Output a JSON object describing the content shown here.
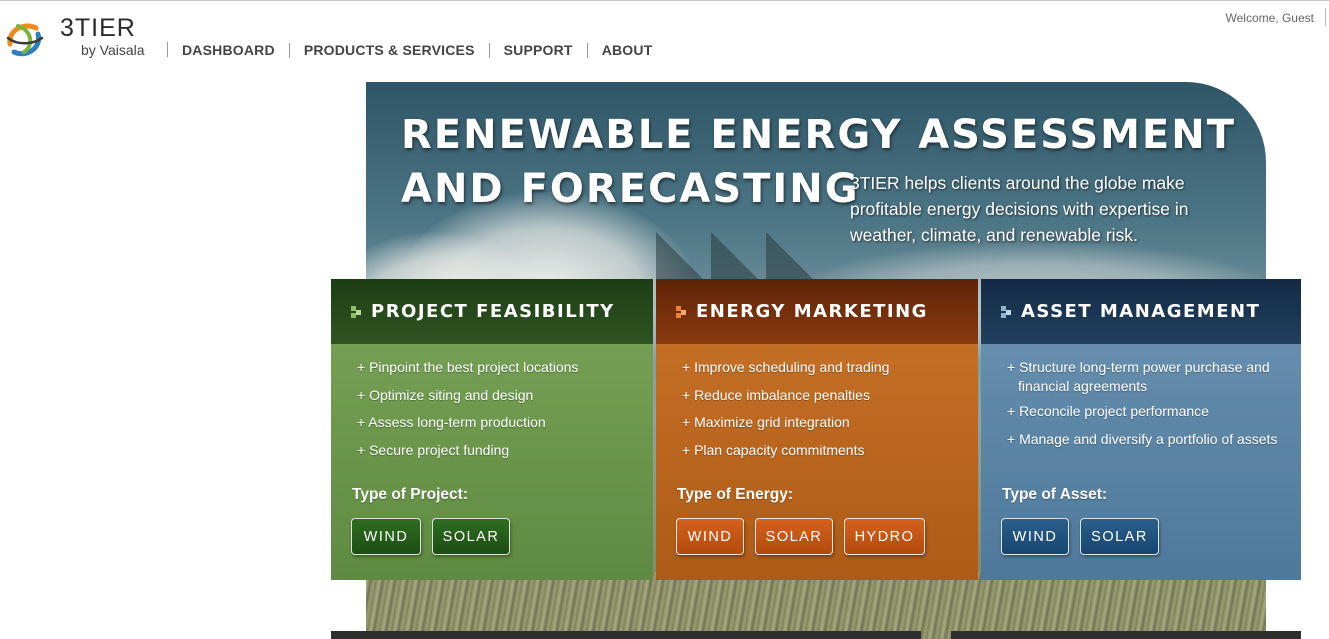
{
  "header": {
    "logo_name": "3TIER",
    "logo_sub": "by Vaisala",
    "nav": [
      "DASHBOARD",
      "PRODUCTS & SERVICES",
      "SUPPORT",
      "ABOUT"
    ],
    "welcome": "Welcome, Guest"
  },
  "hero": {
    "title_line1": "RENEWABLE ENERGY ASSESSMENT",
    "title_line2": "AND FORECASTING",
    "description": "3TIER helps clients around the globe make profitable energy decisions with expertise in weather, climate, and renewable risk."
  },
  "panels": [
    {
      "title": "PROJECT FEASIBILITY",
      "bullets": [
        "+ Pinpoint the best project locations",
        "+ Optimize siting and design",
        "+ Assess long-term production",
        "+ Secure project funding"
      ],
      "type_label": "Type of Project:",
      "buttons": [
        "WIND",
        "SOLAR"
      ],
      "icon_color": "#8fbf6a"
    },
    {
      "title": "ENERGY MARKETING",
      "bullets": [
        "+ Improve scheduling and trading",
        "+ Reduce imbalance penalties",
        "+ Maximize grid integration",
        "+ Plan capacity commitments"
      ],
      "type_label": "Type of Energy:",
      "buttons": [
        "WIND",
        "SOLAR",
        "HYDRO"
      ],
      "icon_color": "#e8823a"
    },
    {
      "title": "ASSET MANAGEMENT",
      "bullets": [
        "+ Structure long-term power purchase and financial agreements",
        "+ Reconcile project performance",
        "+ Manage and diversify a portfolio of assets"
      ],
      "type_label": "Type of Asset:",
      "buttons": [
        "WIND",
        "SOLAR"
      ],
      "icon_color": "#8fb2d0"
    }
  ],
  "colors": {
    "feasibility": "#6f9a4f",
    "marketing": "#bf6a22",
    "asset": "#5f88a8"
  }
}
